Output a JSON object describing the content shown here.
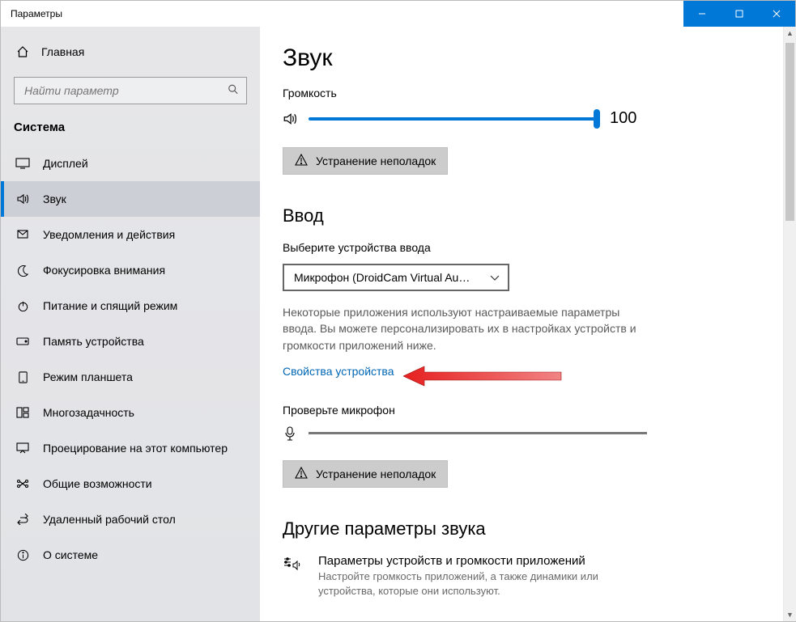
{
  "window": {
    "title": "Параметры"
  },
  "sidebar": {
    "home": "Главная",
    "search_placeholder": "Найти параметр",
    "group": "Система",
    "items": [
      {
        "label": "Дисплей"
      },
      {
        "label": "Звук"
      },
      {
        "label": "Уведомления и действия"
      },
      {
        "label": "Фокусировка внимания"
      },
      {
        "label": "Питание и спящий режим"
      },
      {
        "label": "Память устройства"
      },
      {
        "label": "Режим планшета"
      },
      {
        "label": "Многозадачность"
      },
      {
        "label": "Проецирование на этот компьютер"
      },
      {
        "label": "Общие возможности"
      },
      {
        "label": "Удаленный рабочий стол"
      },
      {
        "label": "О системе"
      }
    ]
  },
  "page": {
    "title": "Звук",
    "volume_label": "Громкость",
    "volume_value": "100",
    "troubleshoot": "Устранение неполадок",
    "input_heading": "Ввод",
    "input_select_label": "Выберите устройства ввода",
    "input_selected": "Микрофон (DroidCam Virtual Au…",
    "input_desc": "Некоторые приложения используют настраиваемые параметры ввода. Вы можете персонализировать их в настройках устройств и громкости приложений ниже.",
    "device_props_link": "Свойства устройства",
    "test_mic_label": "Проверьте микрофон",
    "other_heading": "Другие параметры звука",
    "other_item_title": "Параметры устройств и громкости приложений",
    "other_item_desc": "Настройте громкость приложений, а также динамики или устройства, которые они используют."
  }
}
